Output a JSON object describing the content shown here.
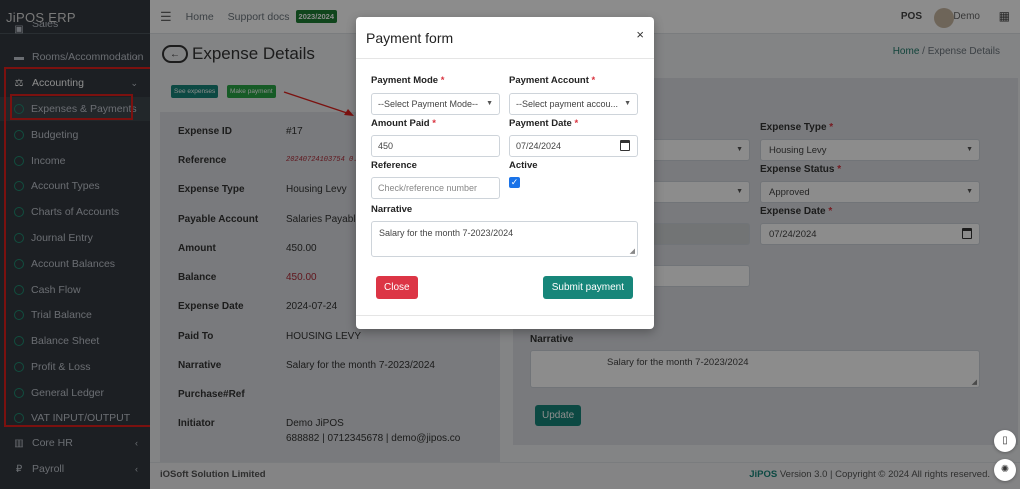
{
  "brand": "JiPOS ERP",
  "sidebar": {
    "items": [
      {
        "label": "Sales",
        "icon": "cart-icon"
      },
      {
        "label": "Rooms/Accommodation",
        "icon": "bed-icon"
      },
      {
        "label": "Accounting",
        "icon": "scale-icon"
      },
      {
        "label": "Expenses & Payments"
      },
      {
        "label": "Budgeting"
      },
      {
        "label": "Income"
      },
      {
        "label": "Account Types"
      },
      {
        "label": "Charts of Accounts"
      },
      {
        "label": "Journal Entry"
      },
      {
        "label": "Account Balances"
      },
      {
        "label": "Cash Flow"
      },
      {
        "label": "Trial Balance"
      },
      {
        "label": "Balance Sheet"
      },
      {
        "label": "Profit & Loss"
      },
      {
        "label": "General Ledger"
      },
      {
        "label": "VAT INPUT/OUTPUT"
      },
      {
        "label": "Core HR",
        "icon": "building-icon"
      },
      {
        "label": "Payroll",
        "icon": "money-icon"
      }
    ]
  },
  "topbar": {
    "home": "Home",
    "support": "Support docs",
    "year_badge": "2023/2024",
    "pos": "POS",
    "user": "Demo"
  },
  "page": {
    "title": "Expense Details",
    "breadcrumb_home": "Home",
    "breadcrumb_current": "Expense Details",
    "see_expenses": "See expenses",
    "make_payment": "Make payment"
  },
  "details": [
    {
      "key": "Expense ID",
      "value": "#17"
    },
    {
      "key": "Reference",
      "value": "20240724103754 0.316..."
    },
    {
      "key": "Expense Type",
      "value": "Housing Levy"
    },
    {
      "key": "Payable Account",
      "value": "Salaries Payable"
    },
    {
      "key": "Amount",
      "value": "450.00"
    },
    {
      "key": "Balance",
      "value": "450.00"
    },
    {
      "key": "Expense Date",
      "value": "2024-07-24"
    },
    {
      "key": "Paid To",
      "value": "HOUSING LEVY"
    },
    {
      "key": "Narrative",
      "value": "Salary for the month 7-2023/2024"
    },
    {
      "key": "Purchase#Ref",
      "value": ""
    },
    {
      "key": "Initiator",
      "value": "Demo JiPOS",
      "value2": "688882 | 0712345678 | demo@jipos.co"
    }
  ],
  "edit_form": {
    "expense_type_label": "Expense Type",
    "expense_type_value": "Housing Levy",
    "expense_status_label": "Expense Status",
    "expense_status_value": "Approved",
    "expense_date_label": "Expense Date",
    "expense_date_value": "07/24/2024",
    "narrative_label": "Narrative",
    "narrative_value": "Salary for the month 7-2023/2024",
    "update": "Update"
  },
  "modal": {
    "title": "Payment form",
    "payment_mode_label": "Payment Mode",
    "payment_mode_value": "--Select Payment Mode--",
    "payment_account_label": "Payment Account",
    "payment_account_value": "--Select payment accou...",
    "amount_label": "Amount Paid",
    "amount_value": "450",
    "date_label": "Payment Date",
    "date_value": "07/24/2024",
    "reference_label": "Reference",
    "reference_placeholder": "Check/reference number",
    "active_label": "Active",
    "narrative_label": "Narrative",
    "narrative_value": "Salary for the month 7-2023/2024",
    "close": "Close",
    "submit": "Submit payment"
  },
  "footer": {
    "left": "iOSoft Solution Limited",
    "brand": "JiPOS",
    "right": " Version 3.0 | Copyright © 2024 All rights reserved."
  },
  "colors": {
    "sidebar": "#343a40",
    "accent": "#17867a",
    "danger": "#dc3545",
    "highlight": "#e0201d"
  }
}
